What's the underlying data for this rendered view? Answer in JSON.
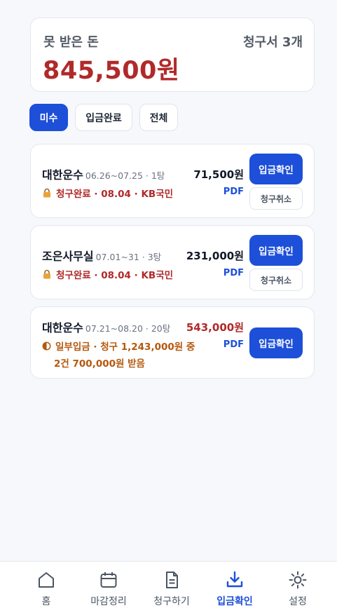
{
  "summary": {
    "label": "못 받은 돈",
    "count": "청구서 3개",
    "amount": "845,500원"
  },
  "filters": [
    {
      "label": "미수",
      "active": true
    },
    {
      "label": "입금완료",
      "active": false
    },
    {
      "label": "전체",
      "active": false
    }
  ],
  "items": [
    {
      "client": "대한운수",
      "meta": "06.26~07.25 · 1탕",
      "amount": "71,500원",
      "status_icon": "lock-icon",
      "status": "청구완료 · 08.04 · KB국민",
      "pdf": "PDF",
      "confirm": "입금확인",
      "cancel": "청구취소"
    },
    {
      "client": "조은사무실",
      "meta": "07.01~31 · 3탕",
      "amount": "231,000원",
      "status_icon": "lock-icon",
      "status": "청구완료 · 08.04 · KB국민",
      "pdf": "PDF",
      "confirm": "입금확인",
      "cancel": "청구취소"
    },
    {
      "client": "대한운수",
      "meta": "07.21~08.20 · 20탕",
      "amount": "543,000원",
      "status_icon": "half-circle-icon",
      "status": "일부입금 · 청구 1,243,000원 중",
      "status_line2": "2건 700,000원 받음",
      "pdf": "PDF",
      "confirm": "입금확인"
    }
  ],
  "tabs": [
    {
      "label": "홈",
      "icon": "home-icon",
      "active": false
    },
    {
      "label": "마감정리",
      "icon": "calendar-icon",
      "active": false
    },
    {
      "label": "청구하기",
      "icon": "document-icon",
      "active": false
    },
    {
      "label": "입금확인",
      "icon": "download-icon",
      "active": true
    },
    {
      "label": "설정",
      "icon": "gear-icon",
      "active": false
    }
  ],
  "colors": {
    "accent": "#1d4fd8",
    "due_red": "#b02a2a",
    "partial_orange": "#b4590e",
    "lock_orange": "#e8a33a"
  }
}
